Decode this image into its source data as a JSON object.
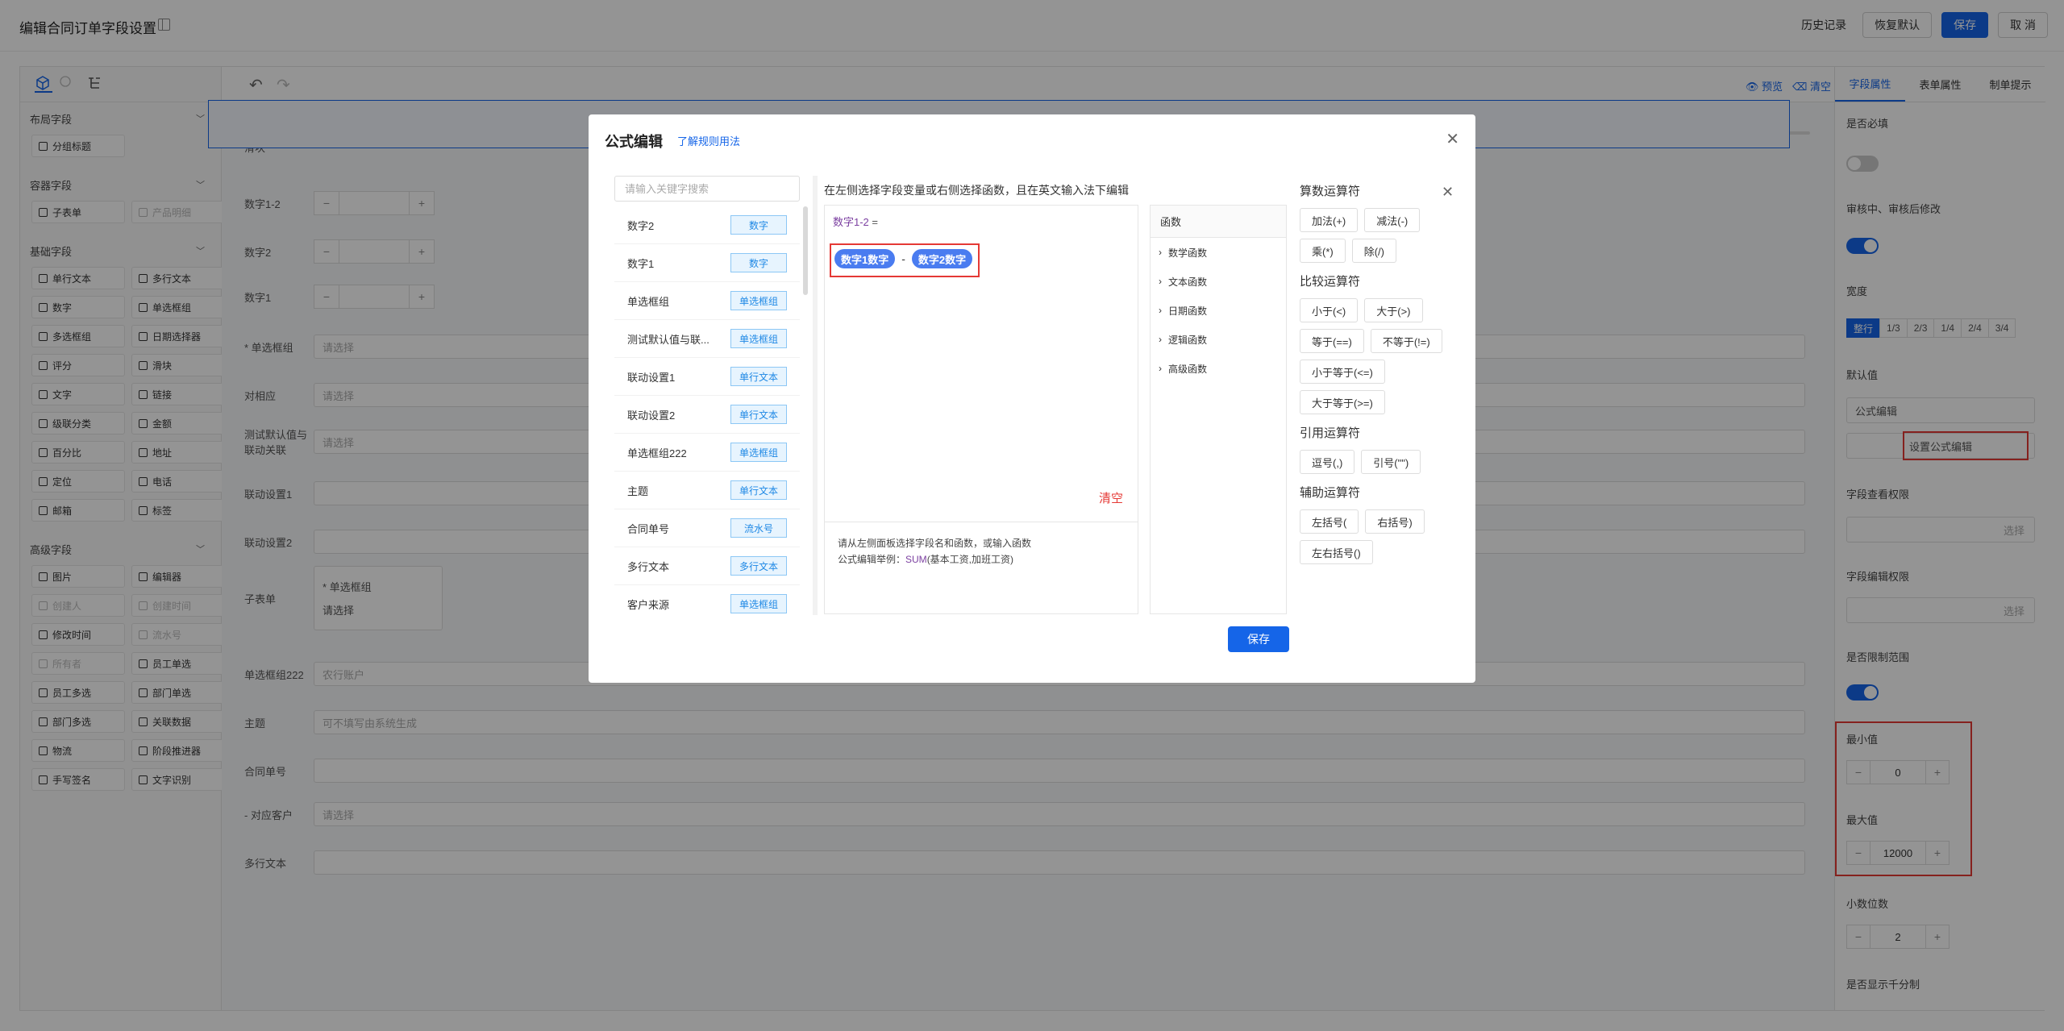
{
  "header": {
    "title": "编辑合同订单字段设置",
    "history": "历史记录",
    "restore": "恢复默认",
    "save": "保存",
    "cancel": "取 消"
  },
  "left": {
    "sections": [
      {
        "title": "布局字段",
        "items": [
          {
            "label": "分组标题",
            "disabled": false
          }
        ]
      },
      {
        "title": "容器字段",
        "items": [
          {
            "label": "子表单",
            "disabled": false
          },
          {
            "label": "产品明细",
            "disabled": true
          }
        ]
      },
      {
        "title": "基础字段",
        "items": [
          {
            "label": "单行文本",
            "disabled": false
          },
          {
            "label": "多行文本",
            "disabled": false
          },
          {
            "label": "数字",
            "disabled": false
          },
          {
            "label": "单选框组",
            "disabled": false
          },
          {
            "label": "多选框组",
            "disabled": false
          },
          {
            "label": "日期选择器",
            "disabled": false
          },
          {
            "label": "评分",
            "disabled": false
          },
          {
            "label": "滑块",
            "disabled": false
          },
          {
            "label": "文字",
            "disabled": false
          },
          {
            "label": "链接",
            "disabled": false
          },
          {
            "label": "级联分类",
            "disabled": false
          },
          {
            "label": "金额",
            "disabled": false
          },
          {
            "label": "百分比",
            "disabled": false
          },
          {
            "label": "地址",
            "disabled": false
          },
          {
            "label": "定位",
            "disabled": false
          },
          {
            "label": "电话",
            "disabled": false
          },
          {
            "label": "邮箱",
            "disabled": false
          },
          {
            "label": "标签",
            "disabled": false
          }
        ]
      },
      {
        "title": "高级字段",
        "items": [
          {
            "label": "图片",
            "disabled": false
          },
          {
            "label": "编辑器",
            "disabled": false
          },
          {
            "label": "创建人",
            "disabled": true
          },
          {
            "label": "创建时间",
            "disabled": true
          },
          {
            "label": "修改时间",
            "disabled": false
          },
          {
            "label": "流水号",
            "disabled": true
          },
          {
            "label": "所有者",
            "disabled": true
          },
          {
            "label": "员工单选",
            "disabled": false
          },
          {
            "label": "员工多选",
            "disabled": false
          },
          {
            "label": "部门单选",
            "disabled": false
          },
          {
            "label": "部门多选",
            "disabled": false
          },
          {
            "label": "关联数据",
            "disabled": false
          },
          {
            "label": "物流",
            "disabled": false
          },
          {
            "label": "阶段推进器",
            "disabled": false
          },
          {
            "label": "手写签名",
            "disabled": false
          },
          {
            "label": "文字识别",
            "disabled": false
          }
        ]
      }
    ]
  },
  "canvas": {
    "preview": "预览",
    "clear": "清空",
    "rows": [
      {
        "label": "滑块"
      },
      {
        "label": "数字1-2"
      },
      {
        "label": "数字2"
      },
      {
        "label": "数字1"
      },
      {
        "label": "* 单选框组",
        "ph": "请选择"
      },
      {
        "label": "对相应",
        "ph": "请选择"
      },
      {
        "label": "测试默认值与联动关联",
        "ph": "请选择"
      },
      {
        "label": "联动设置1"
      },
      {
        "label": "联动设置2"
      },
      {
        "label": "子表单",
        "sub_label": "* 单选框组",
        "ph": "请选择"
      },
      {
        "label": "单选框组222",
        "ph": "农行账户"
      },
      {
        "label": "主题",
        "ph": "可不填写由系统生成"
      },
      {
        "label": "合同单号"
      },
      {
        "label": "- 对应客户",
        "ph": "请选择"
      },
      {
        "label": "多行文本"
      }
    ]
  },
  "right": {
    "tabs": [
      "字段属性",
      "表单属性",
      "制单提示"
    ],
    "required": "是否必填",
    "edit_after": "审核中、审核后修改",
    "width": "宽度",
    "width_opts": [
      "整行",
      "1/3",
      "2/3",
      "1/4",
      "2/4",
      "3/4"
    ],
    "default": "默认值",
    "default_select": "公式编辑",
    "formula_btn": "设置公式编辑",
    "view_perm": "字段查看权限",
    "edit_perm": "字段编辑权限",
    "select": "选择",
    "limit": "是否限制范围",
    "min": "最小值",
    "min_val": "0",
    "max": "最大值",
    "max_val": "12000",
    "decimals": "小数位数",
    "decimals_val": "2",
    "thousand": "是否显示千分制"
  },
  "modal": {
    "title": "公式编辑",
    "rule_link": "了解规则用法",
    "search_ph": "请输入关键字搜索",
    "fields": [
      {
        "name": "数字2",
        "type": "数字"
      },
      {
        "name": "数字1",
        "type": "数字"
      },
      {
        "name": "单选框组",
        "type": "单选框组"
      },
      {
        "name": "测试默认值与联...",
        "type": "单选框组"
      },
      {
        "name": "联动设置1",
        "type": "单行文本"
      },
      {
        "name": "联动设置2",
        "type": "单行文本"
      },
      {
        "name": "单选框组222",
        "type": "单选框组"
      },
      {
        "name": "主题",
        "type": "单行文本"
      },
      {
        "name": "合同单号",
        "type": "流水号"
      },
      {
        "name": "多行文本",
        "type": "多行文本"
      },
      {
        "name": "客户来源",
        "type": "单选框组"
      }
    ],
    "instruction": "在左侧选择字段变量或右侧选择函数，且在英文输入法下编辑",
    "target": "数字1-2",
    "eq": "=",
    "chip1": "数字1数字",
    "op": "-",
    "chip2": "数字2数字",
    "clear": "清空",
    "help1": "请从左侧面板选择字段名和函数，或输入函数",
    "help2_prefix": "公式编辑举例：",
    "help2_fn": "SUM",
    "help2_suffix": "(基本工资,加班工资)",
    "fn_head": "函数",
    "fns": [
      "数学函数",
      "文本函数",
      "日期函数",
      "逻辑函数",
      "高级函数"
    ],
    "op_groups": [
      {
        "title": "算数运算符",
        "ops": [
          "加法(+)",
          "减法(-)",
          "乘(*)",
          "除(/)"
        ]
      },
      {
        "title": "比较运算符",
        "ops": [
          "小于(<)",
          "大于(>)",
          "等于(==)",
          "不等于(!=)",
          "小于等于(<=)",
          "大于等于(>=)"
        ]
      },
      {
        "title": "引用运算符",
        "ops": [
          "逗号(,)",
          "引号(\"\")"
        ]
      },
      {
        "title": "辅助运算符",
        "ops": [
          "左括号(",
          "右括号)",
          "左右括号()"
        ]
      }
    ],
    "save": "保存"
  }
}
